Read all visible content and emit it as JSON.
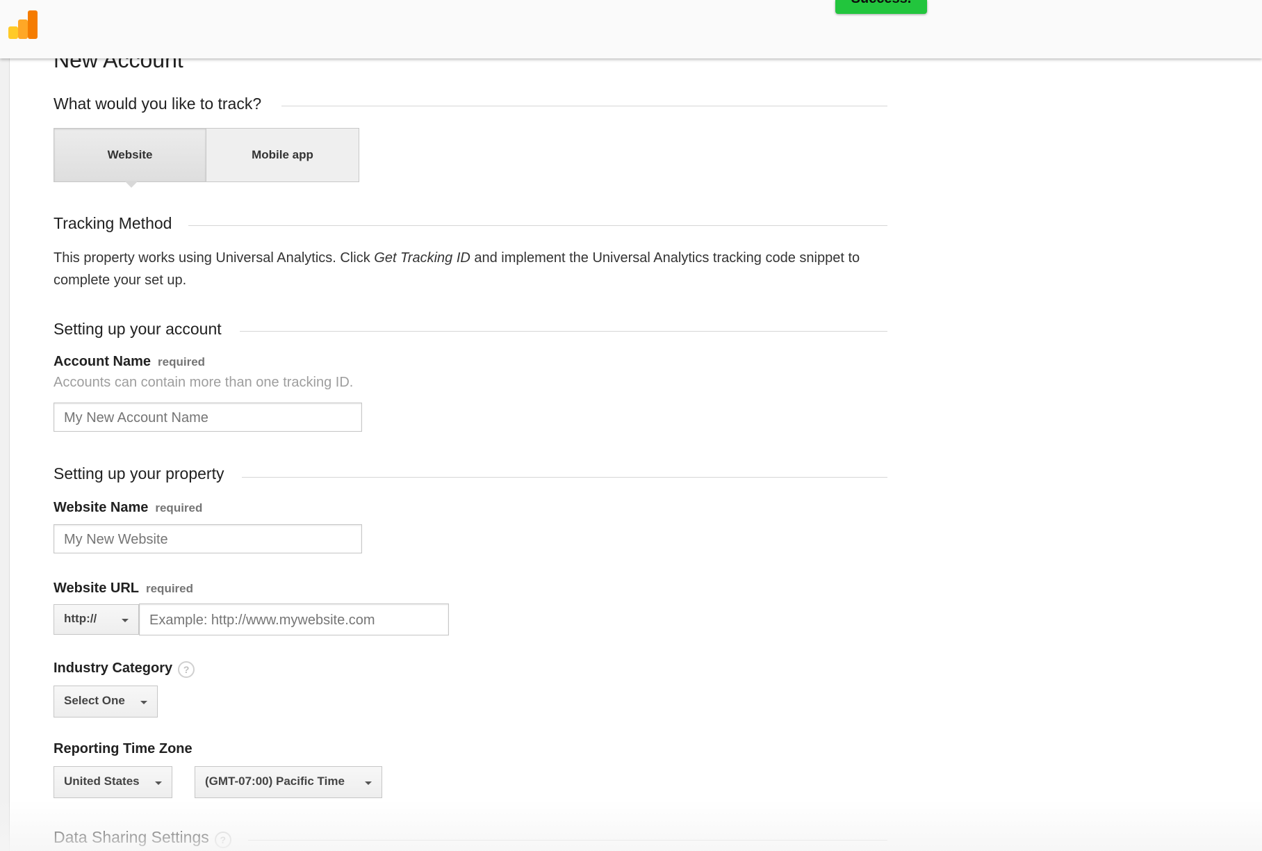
{
  "toast": {
    "text": "Success."
  },
  "page": {
    "title": "New Account"
  },
  "track": {
    "heading": "What would you like to track?",
    "options": [
      "Website",
      "Mobile app"
    ]
  },
  "tracking_method": {
    "heading": "Tracking Method",
    "text_before": "This property works using Universal Analytics. Click ",
    "text_italic": "Get Tracking ID",
    "text_after": " and implement the Universal Analytics tracking code snippet to complete your set up."
  },
  "account": {
    "heading": "Setting up your account",
    "name_label": "Account Name",
    "required": "required",
    "help": "Accounts can contain more than one tracking ID.",
    "name_placeholder": "My New Account Name"
  },
  "property": {
    "heading": "Setting up your property",
    "website_name_label": "Website Name",
    "required": "required",
    "website_name_placeholder": "My New Website",
    "url_label": "Website URL",
    "url_protocol": "http://",
    "url_placeholder": "Example: http://www.mywebsite.com",
    "industry_label": "Industry Category",
    "industry_value": "Select One",
    "timezone_label": "Reporting Time Zone",
    "country_value": "United States",
    "timezone_value": "(GMT-07:00) Pacific Time"
  },
  "data_sharing": {
    "heading": "Data Sharing Settings"
  },
  "icons": {
    "help": "?"
  },
  "colors": {
    "toast": "#22c53d",
    "logo_orange": "#f57c00",
    "logo_yellow": "#ffca28"
  }
}
